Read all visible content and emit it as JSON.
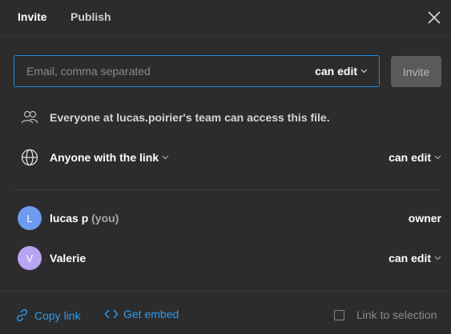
{
  "header": {
    "tabs": [
      {
        "label": "Invite",
        "active": true
      },
      {
        "label": "Publish",
        "active": false
      }
    ],
    "close_icon": "close-icon"
  },
  "invite": {
    "email_placeholder": "Email, comma separated",
    "email_value": "",
    "permission": "can edit",
    "invite_button": "Invite"
  },
  "access": {
    "team_text": "Everyone at lucas.poirier's team can access this file.",
    "link_scope": "Anyone with the link",
    "link_permission": "can edit"
  },
  "members": [
    {
      "initial": "L",
      "name": "lucas p",
      "suffix": "(you)",
      "role": "owner",
      "avatar_color": "#6e9af0"
    },
    {
      "initial": "V",
      "name": "Valerie",
      "suffix": "",
      "role": "can edit",
      "avatar_color": "#b7a4f3"
    }
  ],
  "footer": {
    "copy_link": "Copy link",
    "get_embed": "Get embed",
    "link_to_selection": "Link to selection",
    "link_to_selection_checked": false
  },
  "colors": {
    "background": "#2c2c2c",
    "accent": "#1b8ee6",
    "link": "#2d9cf1",
    "disabled_button": "#5a5a5a"
  }
}
